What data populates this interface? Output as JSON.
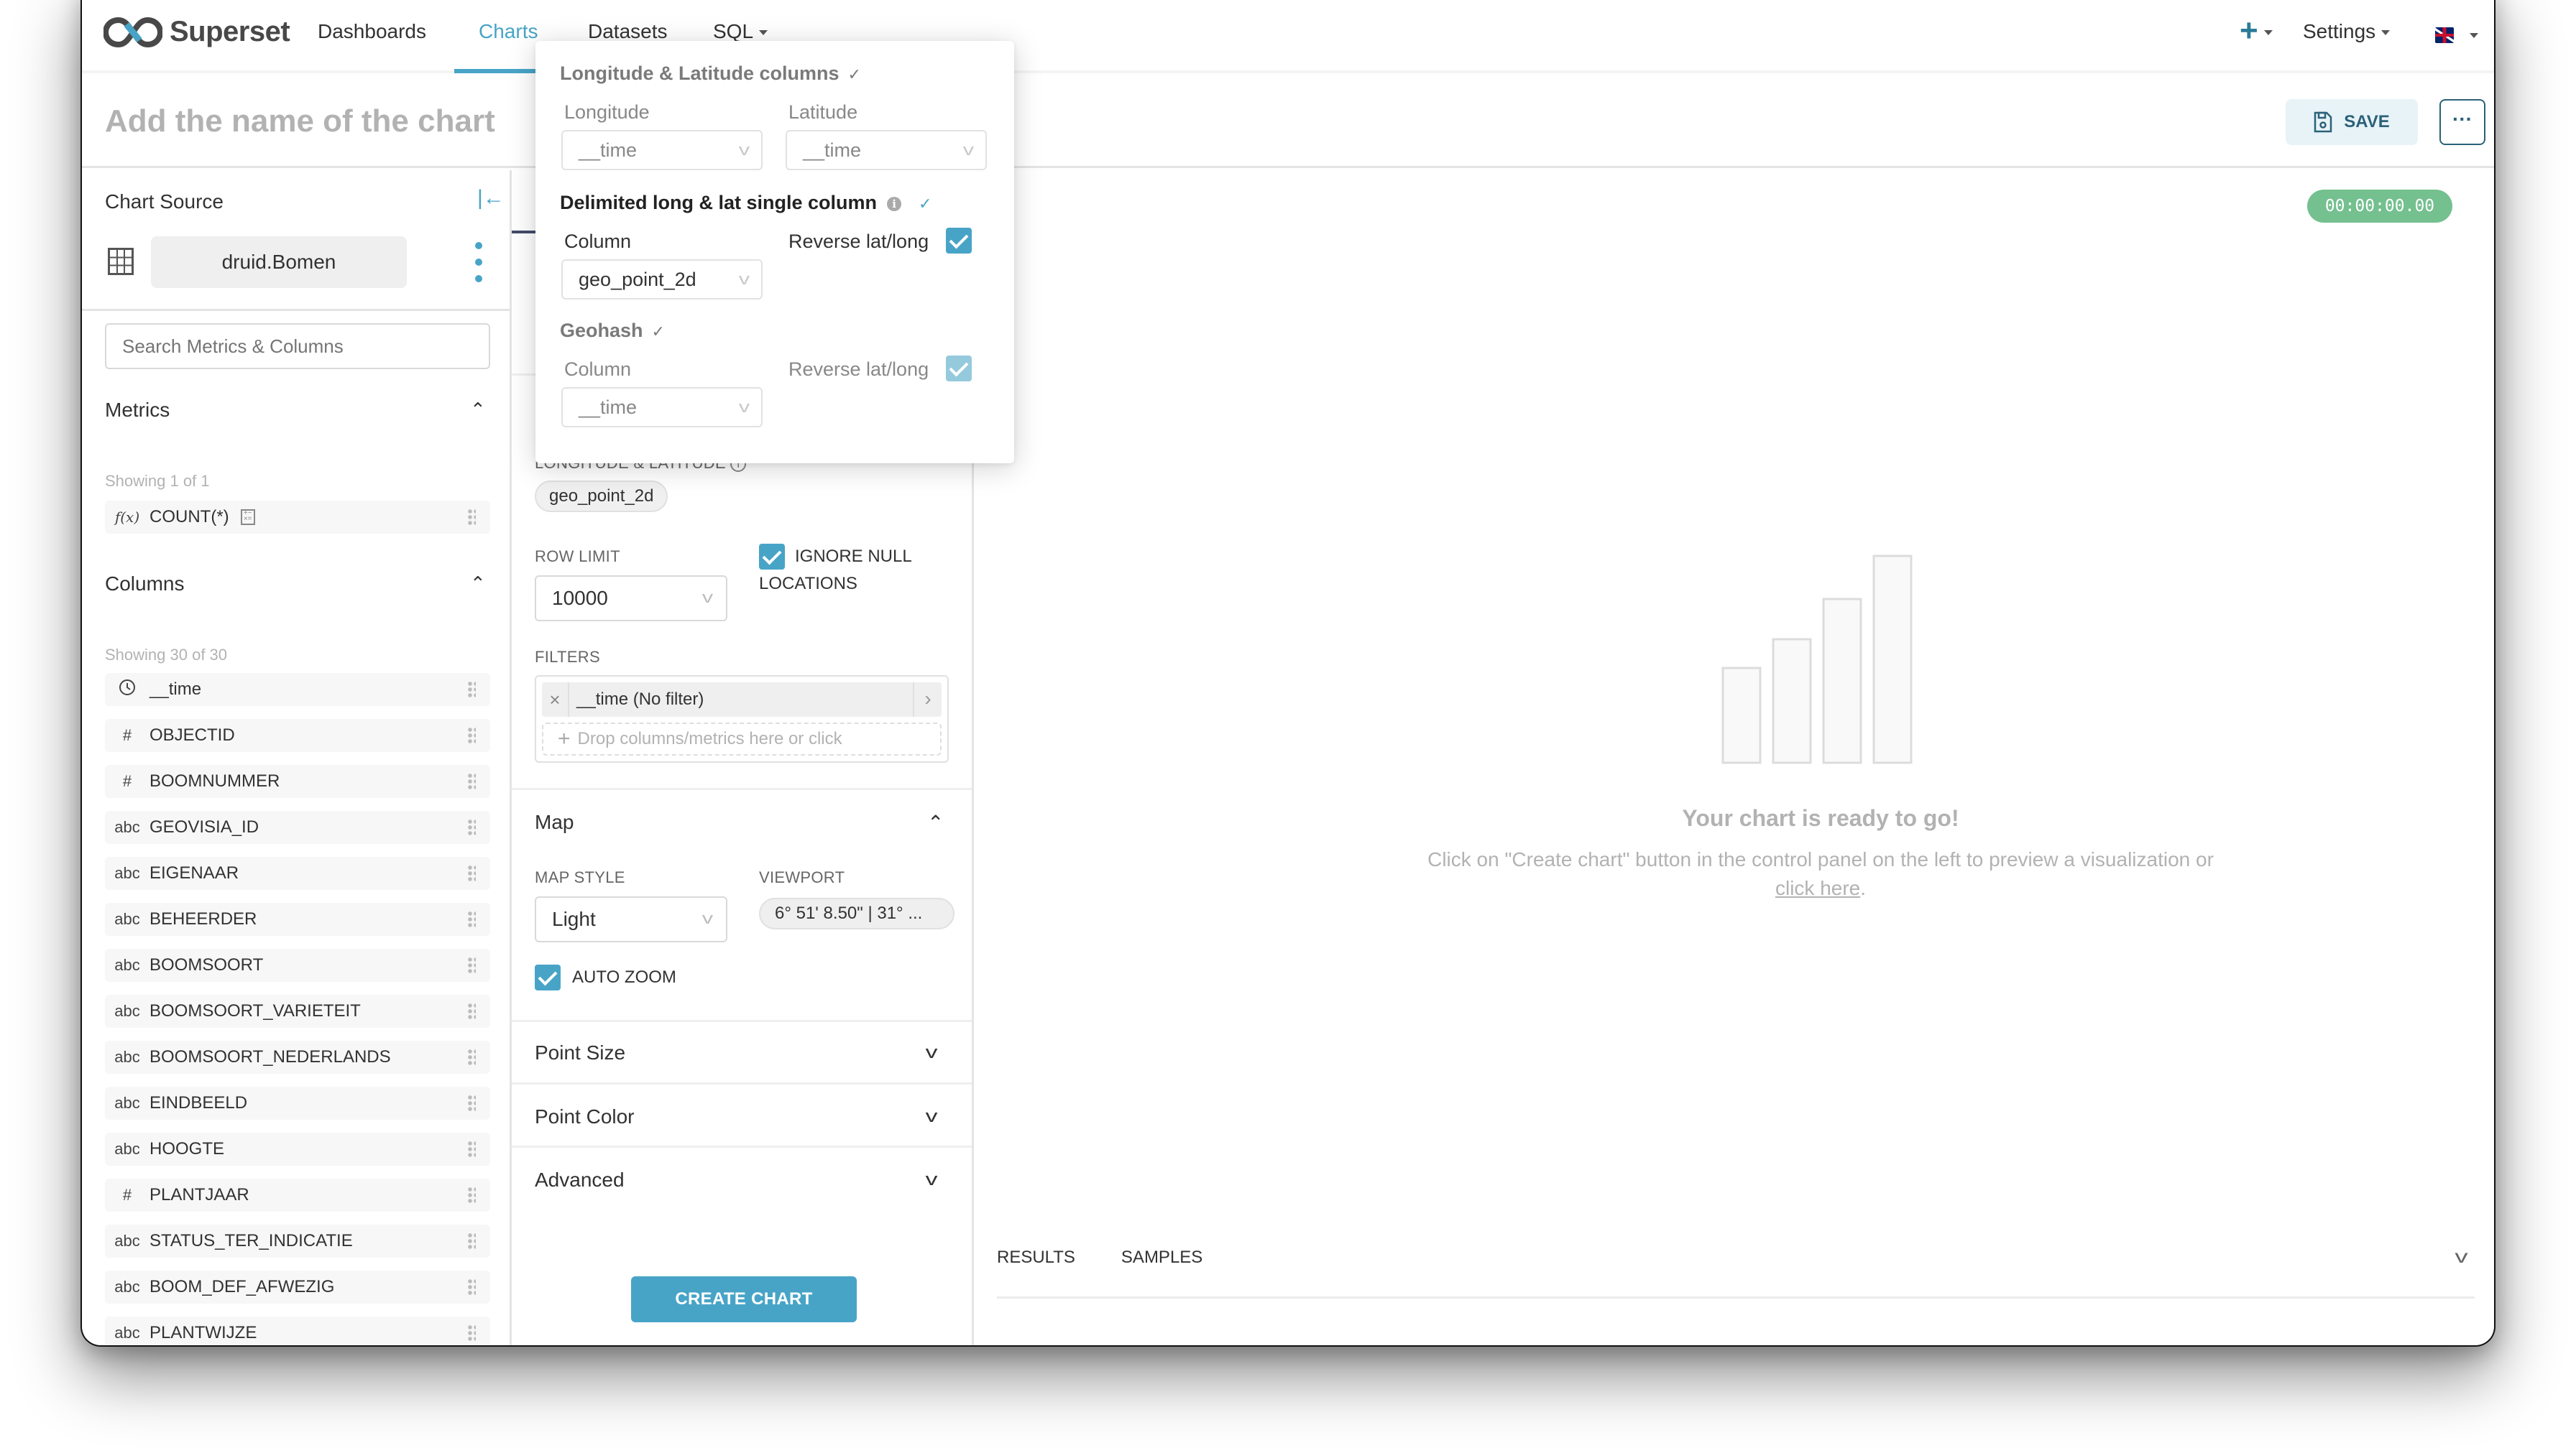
{
  "nav": {
    "brand": "Superset",
    "items": [
      {
        "label": "Dashboards",
        "active": false
      },
      {
        "label": "Charts",
        "active": true
      },
      {
        "label": "Datasets",
        "active": false
      },
      {
        "label": "SQL",
        "active": false,
        "has_caret": true
      }
    ],
    "right": {
      "add_icon": "plus-icon",
      "settings_label": "Settings",
      "language_icon": "uk-flag-icon"
    }
  },
  "header": {
    "chart_title_placeholder": "Add the name of the chart",
    "save_label": "SAVE",
    "more_label": "···"
  },
  "sidebar": {
    "title": "Chart Source",
    "dataset_name": "druid.Bomen",
    "search_placeholder": "Search Metrics & Columns",
    "metrics": {
      "title": "Metrics",
      "showing": "Showing 1 of 1",
      "items": [
        {
          "type": "f(x)",
          "name": "COUNT(*)"
        }
      ]
    },
    "columns": {
      "title": "Columns",
      "showing": "Showing 30 of 30",
      "items": [
        {
          "type": "clock",
          "name": "__time"
        },
        {
          "type": "#",
          "name": "OBJECTID"
        },
        {
          "type": "#",
          "name": "BOOMNUMMER"
        },
        {
          "type": "abc",
          "name": "GEOVISIA_ID"
        },
        {
          "type": "abc",
          "name": "EIGENAAR"
        },
        {
          "type": "abc",
          "name": "BEHEERDER"
        },
        {
          "type": "abc",
          "name": "BOOMSOORT"
        },
        {
          "type": "abc",
          "name": "BOOMSOORT_VARIETEIT"
        },
        {
          "type": "abc",
          "name": "BOOMSOORT_NEDERLANDS"
        },
        {
          "type": "abc",
          "name": "EINDBEELD"
        },
        {
          "type": "abc",
          "name": "HOOGTE"
        },
        {
          "type": "#",
          "name": "PLANTJAAR"
        },
        {
          "type": "abc",
          "name": "STATUS_TER_INDICATIE"
        },
        {
          "type": "abc",
          "name": "BOOM_DEF_AFWEZIG"
        },
        {
          "type": "abc",
          "name": "PLANTWIJZE"
        }
      ]
    }
  },
  "control_panel": {
    "lonlat_label": "LONGITUDE & LATITUDE",
    "lonlat_value": "geo_point_2d",
    "row_limit_label": "ROW LIMIT",
    "row_limit_value": "10000",
    "ignore_null_label_1": "IGNORE NULL",
    "ignore_null_label_2": "LOCATIONS",
    "ignore_null_checked": true,
    "filters_label": "FILTERS",
    "filter_item": "__time (No filter)",
    "filter_drop_placeholder": "Drop columns/metrics here or click",
    "map_section": "Map",
    "map_style_label": "MAP STYLE",
    "map_style_value": "Light",
    "viewport_label": "VIEWPORT",
    "viewport_value": "6° 51' 8.50\" | 31° ...",
    "auto_zoom_label": "AUTO ZOOM",
    "auto_zoom_checked": true,
    "sections_collapsed": [
      "Point Size",
      "Point Color",
      "Advanced"
    ],
    "create_chart_label": "CREATE CHART"
  },
  "popover": {
    "lonlat_heading": "Longitude & Latitude columns",
    "longitude_label": "Longitude",
    "longitude_value": "__time",
    "latitude_label": "Latitude",
    "latitude_value": "__time",
    "delimited_heading": "Delimited long & lat single column",
    "delimited_column_label": "Column",
    "delimited_column_value": "geo_point_2d",
    "delimited_reverse_label": "Reverse lat/long",
    "delimited_reverse_checked": true,
    "geohash_heading": "Geohash",
    "geohash_column_label": "Column",
    "geohash_column_value": "__time",
    "geohash_reverse_label": "Reverse lat/long",
    "geohash_reverse_checked": true
  },
  "chart_area": {
    "timer": "00:00:00.00",
    "empty_title": "Your chart is ready to go!",
    "empty_desc": "Click on \"Create chart\" button in the control panel on the left to preview a visualization or",
    "empty_link": "click here",
    "empty_link_suffix": ".",
    "result_tabs": [
      "RESULTS",
      "SAMPLES"
    ]
  },
  "colors": {
    "accent": "#48a4c7",
    "timer_bg": "#74c08f",
    "save_text": "#2b6178"
  }
}
